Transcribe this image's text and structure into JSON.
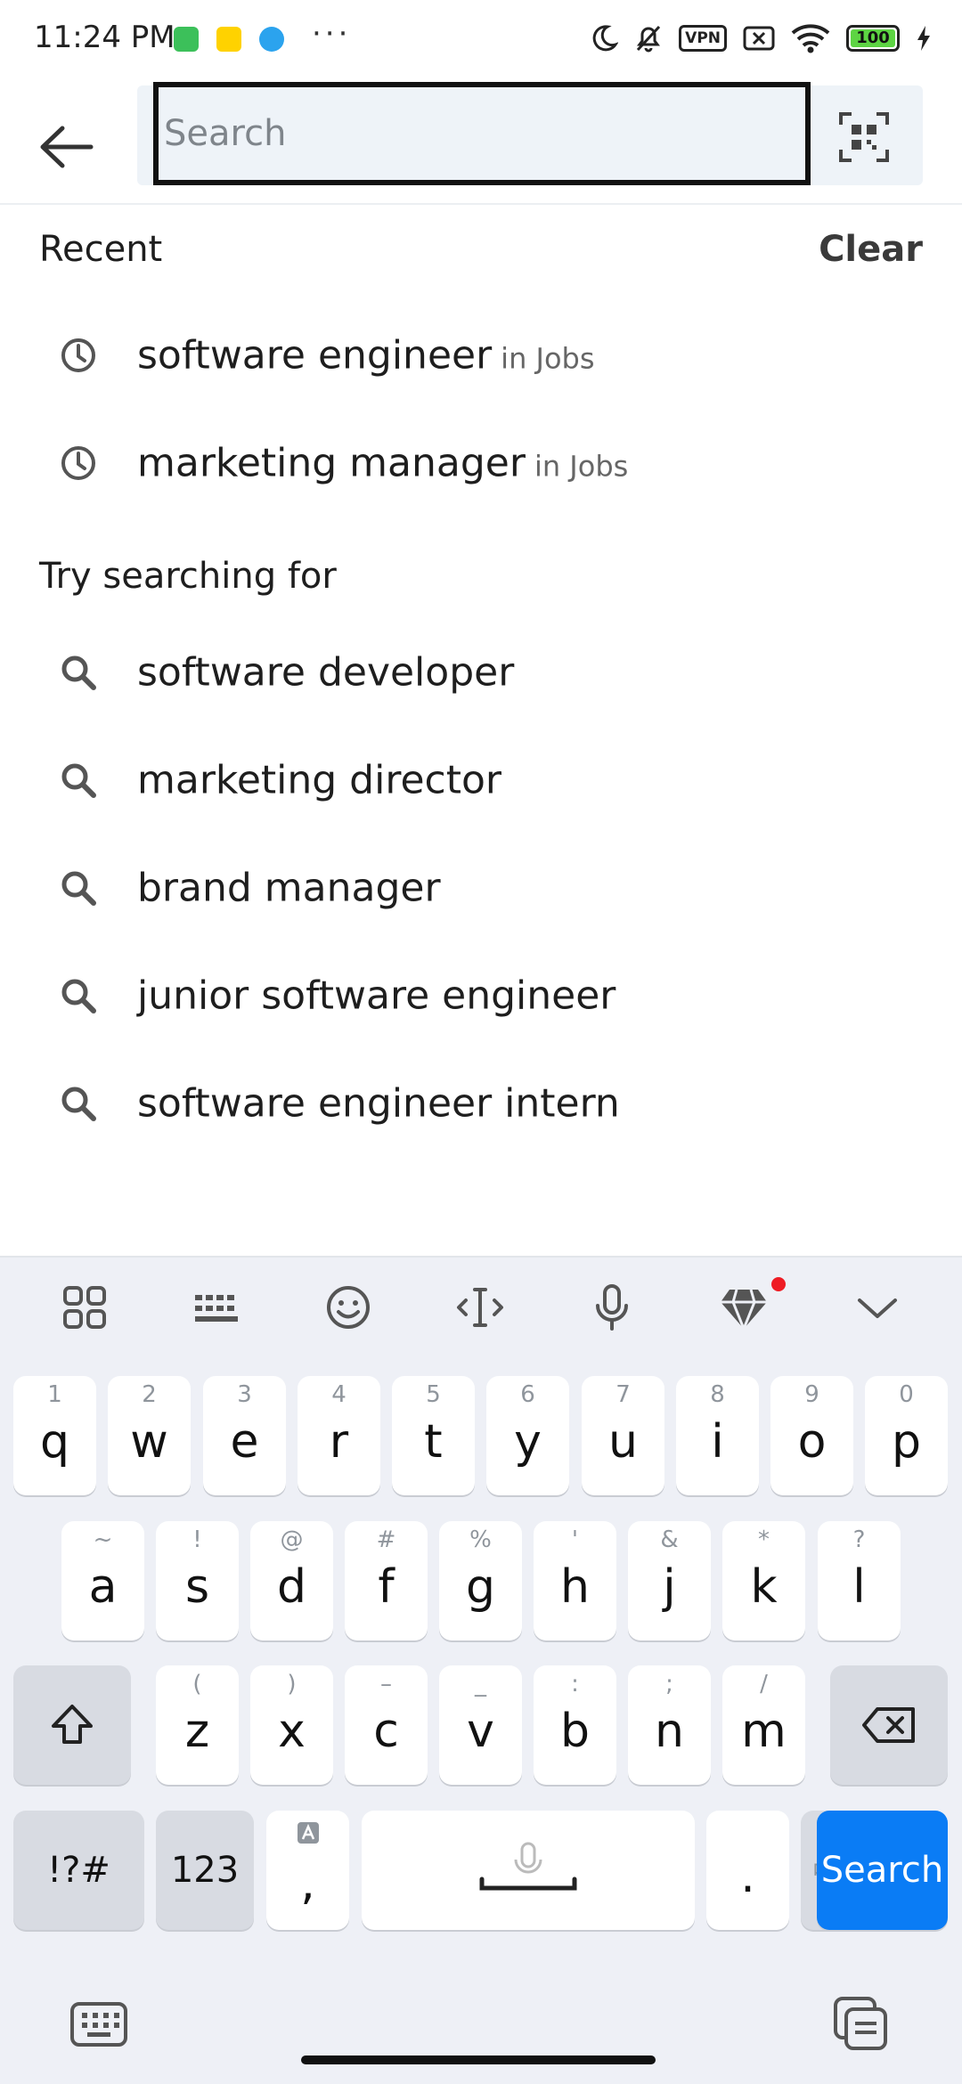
{
  "status_bar": {
    "time": "11:24 PM",
    "vpn": "VPN",
    "battery": "100",
    "dots": "···"
  },
  "search": {
    "placeholder": "Search"
  },
  "recent": {
    "title": "Recent",
    "clear_label": "Clear",
    "items": [
      {
        "text": "software engineer",
        "suffix": "in Jobs"
      },
      {
        "text": "marketing manager",
        "suffix": "in Jobs"
      }
    ]
  },
  "suggestions": {
    "title": "Try searching for",
    "items": [
      "software developer",
      "marketing director",
      "brand manager",
      "junior software engineer",
      "software engineer intern"
    ]
  },
  "keyboard": {
    "row1": [
      [
        "1",
        "q"
      ],
      [
        "2",
        "w"
      ],
      [
        "3",
        "e"
      ],
      [
        "4",
        "r"
      ],
      [
        "5",
        "t"
      ],
      [
        "6",
        "y"
      ],
      [
        "7",
        "u"
      ],
      [
        "8",
        "i"
      ],
      [
        "9",
        "o"
      ],
      [
        "0",
        "p"
      ]
    ],
    "row2": [
      [
        "~",
        "a"
      ],
      [
        "!",
        "s"
      ],
      [
        "@",
        "d"
      ],
      [
        "#",
        "f"
      ],
      [
        "%",
        "g"
      ],
      [
        "'",
        "h"
      ],
      [
        "&",
        "j"
      ],
      [
        "*",
        "k"
      ],
      [
        "?",
        "l"
      ]
    ],
    "row3": [
      [
        "(",
        "z"
      ],
      [
        ")",
        "x"
      ],
      [
        "–",
        "c"
      ],
      [
        "_",
        "v"
      ],
      [
        ":",
        "b"
      ],
      [
        ";",
        "n"
      ],
      [
        "/",
        "m"
      ]
    ],
    "symbols_label": "!?#",
    "numbers_label": "123",
    "comma_label": ",",
    "period_label": ".",
    "lang_label_small": "中",
    "lang_label": "/英",
    "search_label": "Search",
    "accent_color": "#0a7cf5"
  }
}
